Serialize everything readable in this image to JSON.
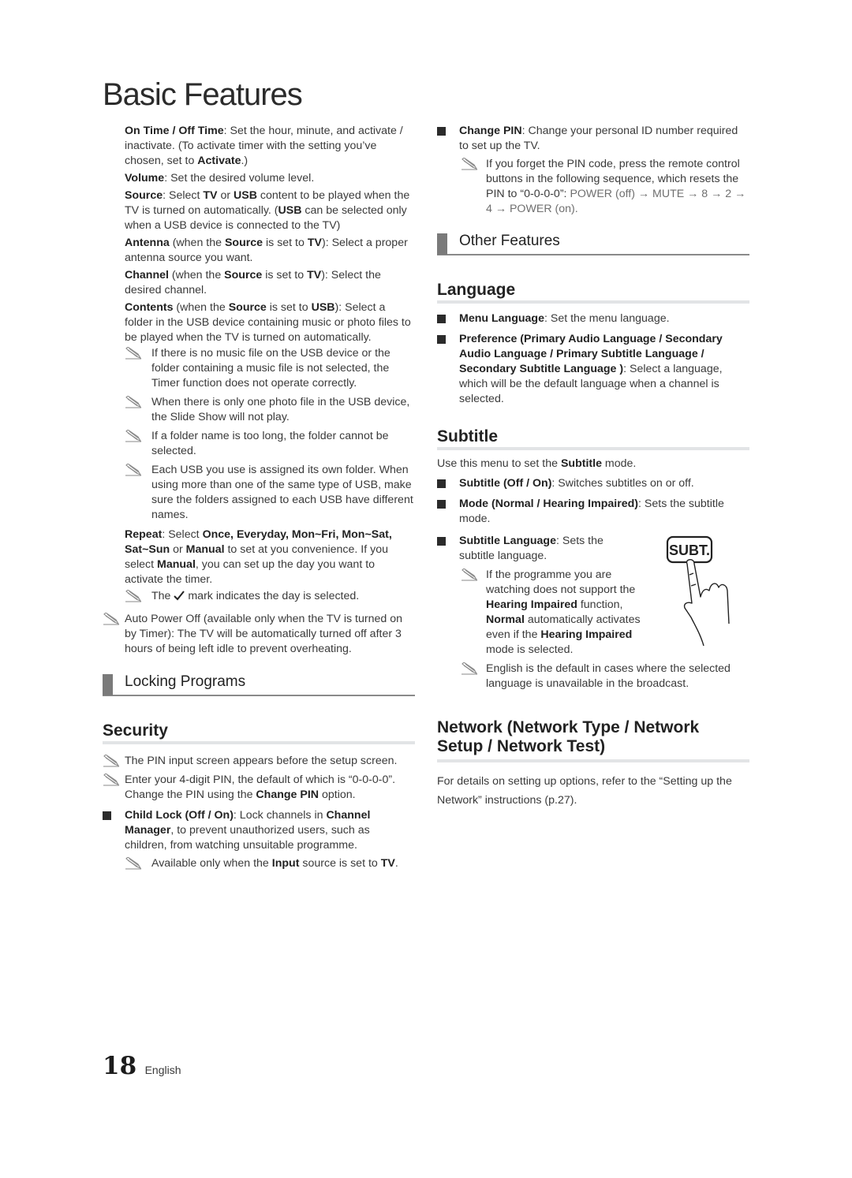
{
  "page": {
    "title": "Basic Features",
    "footer": {
      "page_number": "18",
      "language": "English"
    }
  },
  "left": {
    "timer_items": [
      {
        "term": "On Time / Off Time",
        "text": ": Set the hour, minute, and activate / inactivate. (To activate timer with the setting you’ve chosen, set to ",
        "term2": "Activate",
        "tail": ".)"
      },
      {
        "term": "Volume",
        "text": ": Set the desired volume level."
      },
      {
        "term": "Source",
        "text1": ": Select ",
        "t1": "TV",
        "text2": " or ",
        "t2": "USB",
        "text3": " content to be played when the TV is turned on automatically. (",
        "t3": "USB",
        "text4": " can be selected only when a USB device is connected to the TV)"
      },
      {
        "term": "Antenna",
        "text1": " (when the ",
        "t1": "Source",
        "text2": " is set to ",
        "t2": "TV",
        "text3": "): Select a proper antenna source you want."
      },
      {
        "term": "Channel",
        "text1": " (when the ",
        "t1": "Source",
        "text2": " is set to ",
        "t2": "TV",
        "text3": "): Select the desired channel."
      },
      {
        "term": "Contents",
        "text1": " (when the ",
        "t1": "Source",
        "text2": " is set to ",
        "t2": "USB",
        "text3": "): Select a folder in the USB device containing music or photo files to be played when the TV is turned on automatically."
      }
    ],
    "contents_notes": [
      "If there is no music file on the USB device or the folder containing a music file is not selected, the Timer function does not operate correctly.",
      "When there is only one photo file in the USB device, the Slide Show will not play.",
      "If a folder name is too long, the folder cannot be selected.",
      "Each USB you use is assigned its own folder. When using more than one of the same type of USB, make sure the folders assigned to each USB have different names."
    ],
    "repeat": {
      "term": "Repeat",
      "text1": ": Select ",
      "opts": "Once, Everyday, Mon~Fri, Mon~Sat, Sat~Sun",
      "text2": " or ",
      "manual": "Manual",
      "text3": " to set at you convenience. If you select ",
      "manual2": "Manual",
      "text4": ", you can set up the day you want to activate the timer.",
      "note_pre": "The",
      "note_post": "mark indicates the day is selected."
    },
    "auto_power_off_note": "Auto Power Off (available only when the TV is turned on by Timer): The TV will be automatically turned off after 3 hours of being left idle to prevent overheating.",
    "locking_section": "Locking Programs",
    "security": {
      "heading": "Security",
      "note1": "The PIN input screen appears before the setup screen.",
      "note2_pre": "Enter your 4-digit PIN, the default of which is “0-0-0-0”. Change the PIN using the ",
      "note2_term": "Change PIN",
      "note2_post": " option.",
      "child_lock_term": "Child Lock (Off / On)",
      "child_lock_text1": ": Lock channels in ",
      "child_lock_t1": "Channel Manager",
      "child_lock_text2": ", to prevent unauthorized users, such as children, from watching unsuitable programme.",
      "child_note_pre": "Available only when the ",
      "child_note_t1": "Input",
      "child_note_mid": " source is set to ",
      "child_note_t2": "TV",
      "child_note_post": "."
    }
  },
  "right": {
    "change_pin": {
      "term": "Change PIN",
      "text": ": Change your personal ID number required to set up the TV.",
      "note_pre": "If you forget the PIN code, press the remote control buttons in the following sequence, which resets the PIN to “0-0-0-0”: ",
      "sequence": "POWER (off) → MUTE → 8 → 2 → 4 → POWER (on)."
    },
    "other_section": "Other Features",
    "language": {
      "heading": "Language",
      "menu_term": "Menu Language",
      "menu_text": ": Set the menu language.",
      "pref_term": "Preference (Primary Audio Language / Secondary Audio Language / Primary Subtitle Language / Secondary Subtitle Language )",
      "pref_text": ": Select a language, which will be the default language when a channel is selected."
    },
    "subtitle": {
      "heading": "Subtitle",
      "intro_pre": "Use this menu to set the ",
      "intro_term": "Subtitle",
      "intro_post": " mode.",
      "onoff_term": "Subtitle (Off / On)",
      "onoff_text": ": Switches subtitles on or off.",
      "mode_term": "Mode (Normal / Hearing Impaired)",
      "mode_text": ": Sets the subtitle mode.",
      "lang_term": "Subtitle Language",
      "lang_text": ": Sets the subtitle language.",
      "note1_a": "If the programme you are watching does not support the ",
      "note1_t1": "Hearing Impaired",
      "note1_b": " function, ",
      "note1_t2": "Normal",
      "note1_c": " automatically activates even if the ",
      "note1_t3": "Hearing Impaired",
      "note1_d": " mode is selected.",
      "note2": "English is the default in cases where the selected language is unavailable in the broadcast.",
      "button_label": "SUBT."
    },
    "network": {
      "heading": "Network (Network Type / Network Setup / Network Test)",
      "text": "For details on setting up options, refer to the “Setting up the Network” instructions (p.27)."
    }
  }
}
